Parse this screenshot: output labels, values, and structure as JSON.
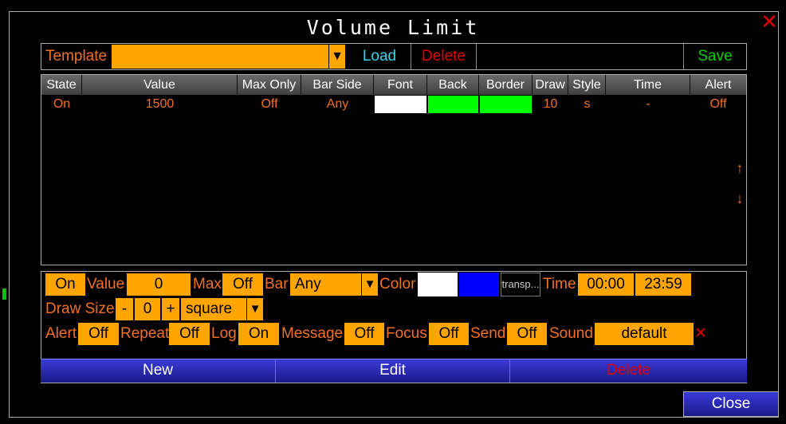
{
  "window": {
    "title": "Volume Limit",
    "close_glyph": "✕"
  },
  "template": {
    "label": "Template",
    "selected": "",
    "caret": "▼",
    "load": "Load",
    "delete": "Delete",
    "save": "Save"
  },
  "grid": {
    "headers": [
      "State",
      "Value",
      "Max Only",
      "Bar Side",
      "Font",
      "Back",
      "Border",
      "Draw",
      "Style",
      "Time",
      "Alert"
    ],
    "rows": [
      {
        "state": "On",
        "value": "1500",
        "max_only": "Off",
        "bar_side": "Any",
        "font_color": "#ffffff",
        "back_color": "#00ff00",
        "border_color": "#00ff00",
        "draw": "10",
        "style": "s",
        "time": "-",
        "alert": "Off"
      }
    ],
    "up_arrow": "↑",
    "down_arrow": "↓"
  },
  "editor": {
    "state": "On",
    "value_label": "Value",
    "value": "0",
    "max_label": "Max",
    "max": "Off",
    "bar_label": "Bar",
    "bar": "Any",
    "caret": "▼",
    "color_label": "Color",
    "font_color": "#ffffff",
    "back_color": "#0000ff",
    "border_text": "transp...",
    "time_label": "Time",
    "time_start": "00:00",
    "time_end": "23:59",
    "draw_size_label": "Draw Size",
    "minus": "-",
    "draw_size": "0",
    "plus": "+",
    "shape": "square",
    "alert_label": "Alert",
    "alert": "Off",
    "repeat_label": "Repeat",
    "repeat": "Off",
    "log_label": "Log",
    "log": "On",
    "message_label": "Message",
    "message": "Off",
    "focus_label": "Focus",
    "focus": "Off",
    "send_label": "Send",
    "send": "Off",
    "sound_label": "Sound",
    "sound": "default",
    "clear_glyph": "✕"
  },
  "buttons": {
    "new": "New",
    "edit": "Edit",
    "delete": "Delete",
    "close": "Close"
  },
  "colors": {
    "accent": "#ffa500",
    "text": "#f07020",
    "load": "#3cd2e6",
    "delete": "#e00000",
    "save": "#00d000"
  }
}
